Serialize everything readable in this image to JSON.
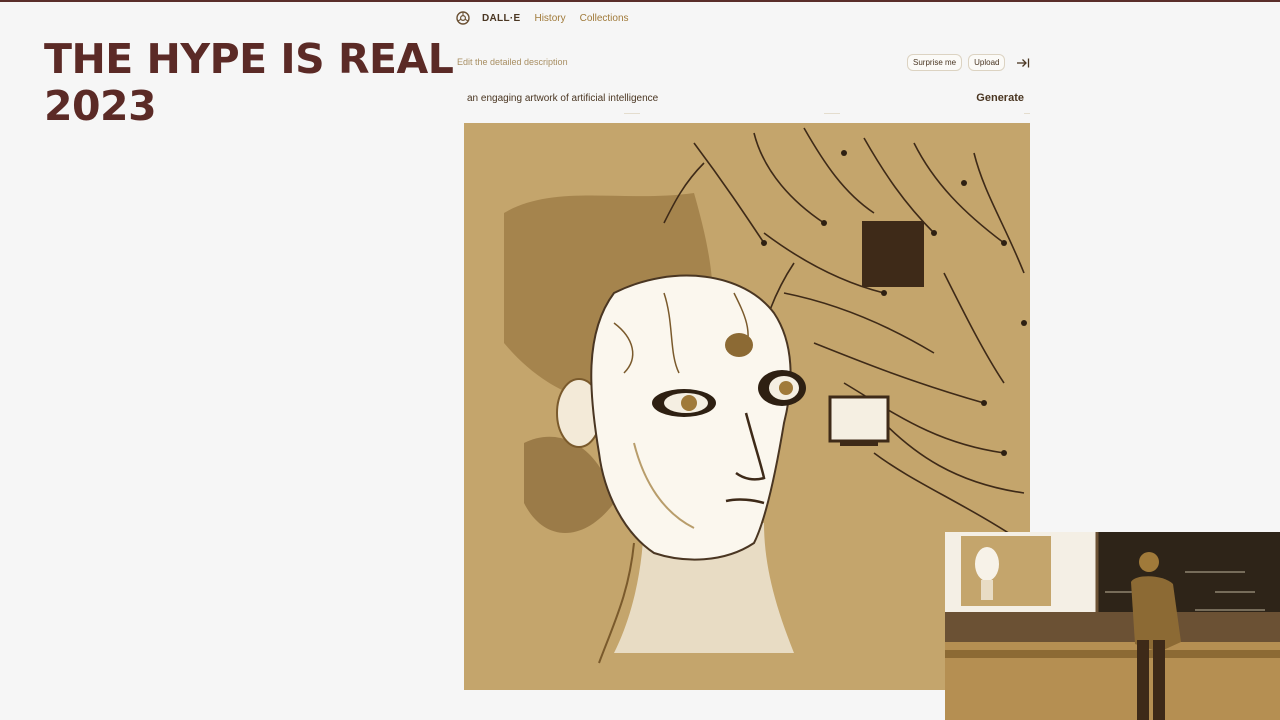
{
  "slide": {
    "title_line1": "THE HYPE IS REAL",
    "title_line2": "2023"
  },
  "dalle": {
    "brand": "DALL·E",
    "nav": [
      "History",
      "Collections"
    ],
    "prompt_hint": "Edit the detailed description",
    "buttons": {
      "surprise": "Surprise me",
      "upload": "Upload"
    },
    "prompt_text": "an engaging artwork of artificial intelligence",
    "generate_label": "Generate"
  },
  "colors": {
    "title": "#5b2a26",
    "artwork_bg": "#c4a56c",
    "accent": "#a07a3a"
  },
  "icons": {
    "logo": "dalle-logo-icon",
    "collapse": "collapse-sidebar-icon"
  }
}
